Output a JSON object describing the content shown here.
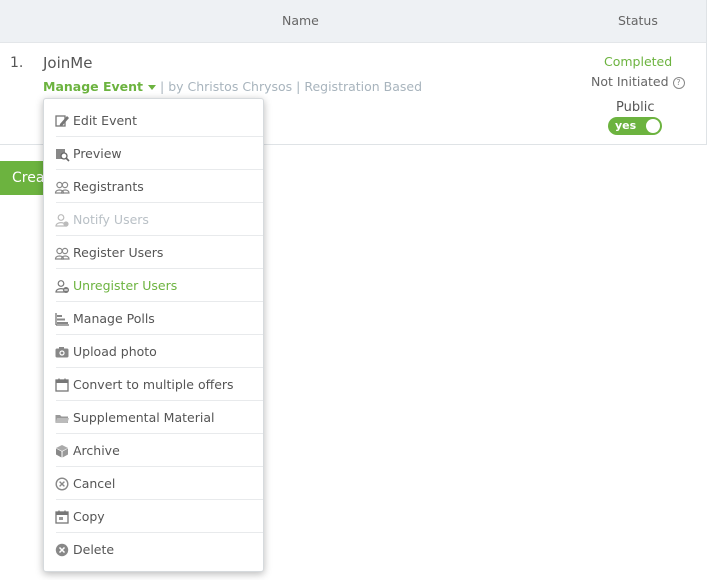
{
  "table": {
    "columns": {
      "name": "Name",
      "status": "Status"
    },
    "row": {
      "index": "1.",
      "title": "JoinMe",
      "manage_label": "Manage Event",
      "meta_text": "| by Christos Chrysos | Registration Based",
      "status_primary": "Completed",
      "status_secondary": "Not Initiated",
      "help_glyph": "?",
      "public_label": "Public",
      "public_toggle": "yes"
    }
  },
  "create_button": {
    "label": "Create"
  },
  "colors": {
    "accent": "#6cb33f",
    "muted": "#a8b4bd",
    "disabled": "#b9c0c6"
  },
  "menu": {
    "items": [
      {
        "label": "Edit Event",
        "icon": "edit-icon"
      },
      {
        "label": "Preview",
        "icon": "preview-icon"
      },
      {
        "label": "Registrants",
        "icon": "users-icon"
      },
      {
        "label": "Notify Users",
        "icon": "notify-user-icon",
        "state": "disabled"
      },
      {
        "label": "Register Users",
        "icon": "users-icon"
      },
      {
        "label": "Unregister Users",
        "icon": "user-remove-icon",
        "state": "hover"
      },
      {
        "label": "Manage Polls",
        "icon": "bar-chart-icon"
      },
      {
        "label": "Upload photo",
        "icon": "camera-icon"
      },
      {
        "label": "Convert to multiple offers",
        "icon": "calendar-icon"
      },
      {
        "label": "Supplemental Material",
        "icon": "folder-icon"
      },
      {
        "label": "Archive",
        "icon": "archive-icon"
      },
      {
        "label": "Cancel",
        "icon": "cancel-icon"
      },
      {
        "label": "Copy",
        "icon": "copy-icon"
      },
      {
        "label": "Delete",
        "icon": "delete-icon"
      }
    ]
  }
}
